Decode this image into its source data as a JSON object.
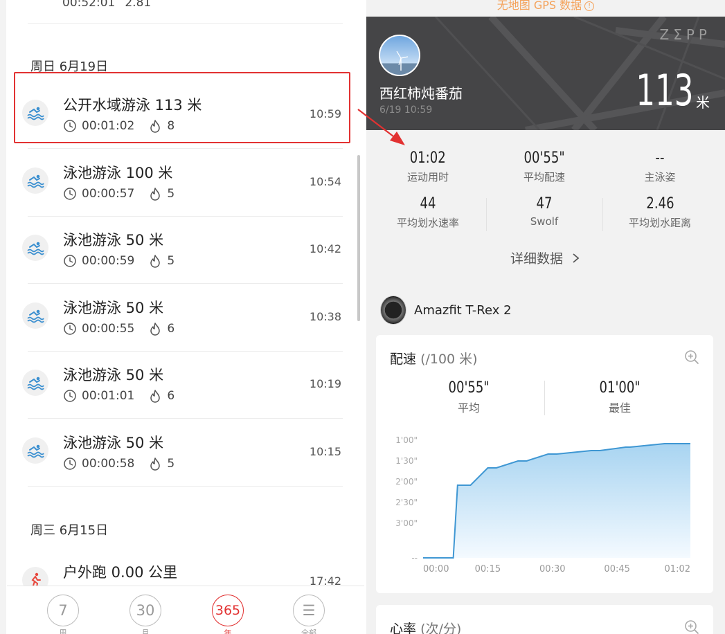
{
  "list": {
    "prev_item": {
      "duration": "00:52:01",
      "calories": "2.81"
    },
    "groups": [
      {
        "date": "周日 6月19日",
        "items": [
          {
            "title": "公开水域游泳 113 米",
            "duration": "00:01:02",
            "calories": "8",
            "time": "10:59",
            "icon": "open-water-swim-icon"
          },
          {
            "title": "泳池游泳 100 米",
            "duration": "00:00:57",
            "calories": "5",
            "time": "10:54",
            "icon": "pool-swim-icon"
          },
          {
            "title": "泳池游泳 50 米",
            "duration": "00:00:59",
            "calories": "5",
            "time": "10:42",
            "icon": "pool-swim-icon"
          },
          {
            "title": "泳池游泳 50 米",
            "duration": "00:00:55",
            "calories": "6",
            "time": "10:38",
            "icon": "pool-swim-icon"
          },
          {
            "title": "泳池游泳 50 米",
            "duration": "00:01:01",
            "calories": "6",
            "time": "10:19",
            "icon": "pool-swim-icon"
          },
          {
            "title": "泳池游泳 50 米",
            "duration": "00:00:58",
            "calories": "5",
            "time": "10:15",
            "icon": "pool-swim-icon"
          }
        ]
      },
      {
        "date": "周三 6月15日",
        "items": [
          {
            "title": "户外跑 0.00 公里",
            "duration": "",
            "calories": "",
            "time": "17:42",
            "icon": "running-icon"
          }
        ]
      }
    ]
  },
  "tabbar": [
    {
      "value": "7",
      "label": "周"
    },
    {
      "value": "30",
      "label": "月"
    },
    {
      "value": "365",
      "label": "年"
    },
    {
      "value": "☰",
      "label": "全部"
    }
  ],
  "detail": {
    "gps_note": "无地图 GPS 数据",
    "brand": "ZΣPP",
    "user": "西红柿炖番茄",
    "datetime": "6/19 10:59",
    "distance": "113",
    "distance_unit": "米",
    "stats": [
      {
        "value": "01:02",
        "label": "运动用时"
      },
      {
        "value": "00'55\"",
        "label": "平均配速"
      },
      {
        "value": "--",
        "label": "主泳姿"
      },
      {
        "value": "44",
        "label": "平均划水速率"
      },
      {
        "value": "47",
        "label": "Swolf"
      },
      {
        "value": "2.46",
        "label": "平均划水距离"
      }
    ],
    "detail_link": "详细数据",
    "device": "Amazfit T-Rex 2",
    "pace_card": {
      "title": "配速",
      "unit": "(/100 米)",
      "avg": {
        "value": "00'55\"",
        "label": "平均"
      },
      "best": {
        "value": "01'00\"",
        "label": "最佳"
      }
    },
    "hr_card": {
      "title": "心率",
      "unit": "(次/分)"
    }
  },
  "chart_data": {
    "type": "area",
    "x_ticks": [
      "00:00",
      "00:15",
      "00:30",
      "00:45",
      "01:02"
    ],
    "y_ticks": [
      "1'00\"",
      "1'30\"",
      "2'00\"",
      "2'30\"",
      "3'00\"",
      "--"
    ],
    "y_reversed": true,
    "x": [
      0,
      7,
      8,
      11,
      15,
      17,
      22,
      24,
      29,
      31,
      39,
      41,
      47,
      48,
      56,
      57,
      62
    ],
    "y": [
      230,
      230,
      125,
      125,
      100,
      100,
      90,
      90,
      80,
      80,
      75,
      75,
      70,
      70,
      65,
      65,
      65
    ],
    "xlim": [
      0,
      62
    ],
    "ylim": [
      60,
      230
    ],
    "y_axis_units": "seconds per 100m (ticks at 60,90,120,150,180; '--' at bottom)",
    "color": "#3f97d3",
    "fill_top": "#a8d4f1",
    "fill_bottom": "#f4faff"
  }
}
